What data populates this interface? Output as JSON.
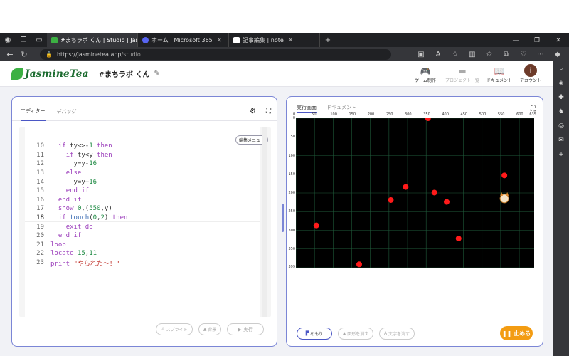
{
  "browser": {
    "tabs": [
      {
        "title": "#まちラボ くん | Studio | Jasmine Tea",
        "active": true,
        "color": "#3cb043"
      },
      {
        "title": "ホーム | Microsoft 365",
        "active": false,
        "color": "#5865f2"
      },
      {
        "title": "記事編集 | note",
        "active": false,
        "color": "#222222"
      }
    ],
    "url_host": "https://jasminetea.app",
    "url_path": "/studio"
  },
  "header": {
    "logo": "JasmineTea",
    "project_name": "#まちラボ くん",
    "nav": [
      {
        "label": "ゲーム制作",
        "icon": "gamepad-icon",
        "enabled": true
      },
      {
        "label": "プロジェクト一覧",
        "icon": "folder-icon",
        "enabled": false
      },
      {
        "label": "ドキュメント",
        "icon": "book-icon",
        "enabled": true
      }
    ],
    "account_initial": "i",
    "account_label": "アカウント"
  },
  "editor": {
    "tabs": [
      "エディター",
      "デバッグ"
    ],
    "menu_button": "編集メニュー",
    "lines": [
      {
        "n": "10",
        "html": "  <span class='kw'>if</span> ty&lt;&gt;-<span class='num'>1</span> <span class='kw'>then</span>"
      },
      {
        "n": "11",
        "html": "    <span class='kw'>if</span> ty&lt;y <span class='kw'>then</span>"
      },
      {
        "n": "12",
        "html": "      y=y-<span class='num'>16</span>"
      },
      {
        "n": "13",
        "html": "    <span class='kw'>else</span>"
      },
      {
        "n": "14",
        "html": "      y=y+<span class='num'>16</span>"
      },
      {
        "n": "15",
        "html": "    <span class='kw'>end if</span>"
      },
      {
        "n": "16",
        "html": "  <span class='kw'>end if</span>"
      },
      {
        "n": "17",
        "html": "  <span class='kw'>show</span> <span class='num'>0</span>,(<span class='num'>550</span>,y)"
      },
      {
        "n": "18",
        "html": "  <span class='kw'>if</span> <span class='fn'>touch</span>(<span class='num'>0</span>,<span class='num'>2</span>) <span class='kw'>then</span>"
      },
      {
        "n": "19",
        "html": "    <span class='kw'>exit do</span>"
      },
      {
        "n": "20",
        "html": "  <span class='kw'>end if</span>"
      },
      {
        "n": "21",
        "html": "<span class='kw'>loop</span>"
      },
      {
        "n": "22",
        "html": "<span class='kw'>locate</span> <span class='num'>15</span>,<span class='num'>11</span>"
      },
      {
        "n": "23",
        "html": "<span class='kw'>print</span> <span class='str'>\"やられた～！\"</span>"
      }
    ],
    "current_line": "18",
    "buttons": [
      "スプライト",
      "背景",
      "実行"
    ]
  },
  "runner": {
    "tabs": [
      "実行画面",
      "ドキュメント"
    ],
    "x_ticks": [
      "0",
      "50",
      "100",
      "150",
      "200",
      "250",
      "300",
      "350",
      "400",
      "450",
      "500",
      "550",
      "600",
      "635"
    ],
    "y_ticks": [
      "0",
      "50",
      "100",
      "150",
      "200",
      "250",
      "300",
      "350",
      "399"
    ],
    "dots": [
      {
        "x": 355,
        "y": 0
      },
      {
        "x": 560,
        "y": 153
      },
      {
        "x": 295,
        "y": 184
      },
      {
        "x": 372,
        "y": 199
      },
      {
        "x": 255,
        "y": 219
      },
      {
        "x": 405,
        "y": 224
      },
      {
        "x": 55,
        "y": 287
      },
      {
        "x": 437,
        "y": 322
      },
      {
        "x": 170,
        "y": 391
      }
    ],
    "player": {
      "x": 560,
      "y": 215
    },
    "buttons": [
      "めもり",
      "図形を消す",
      "文字を消す"
    ],
    "stop_label": "止める"
  }
}
